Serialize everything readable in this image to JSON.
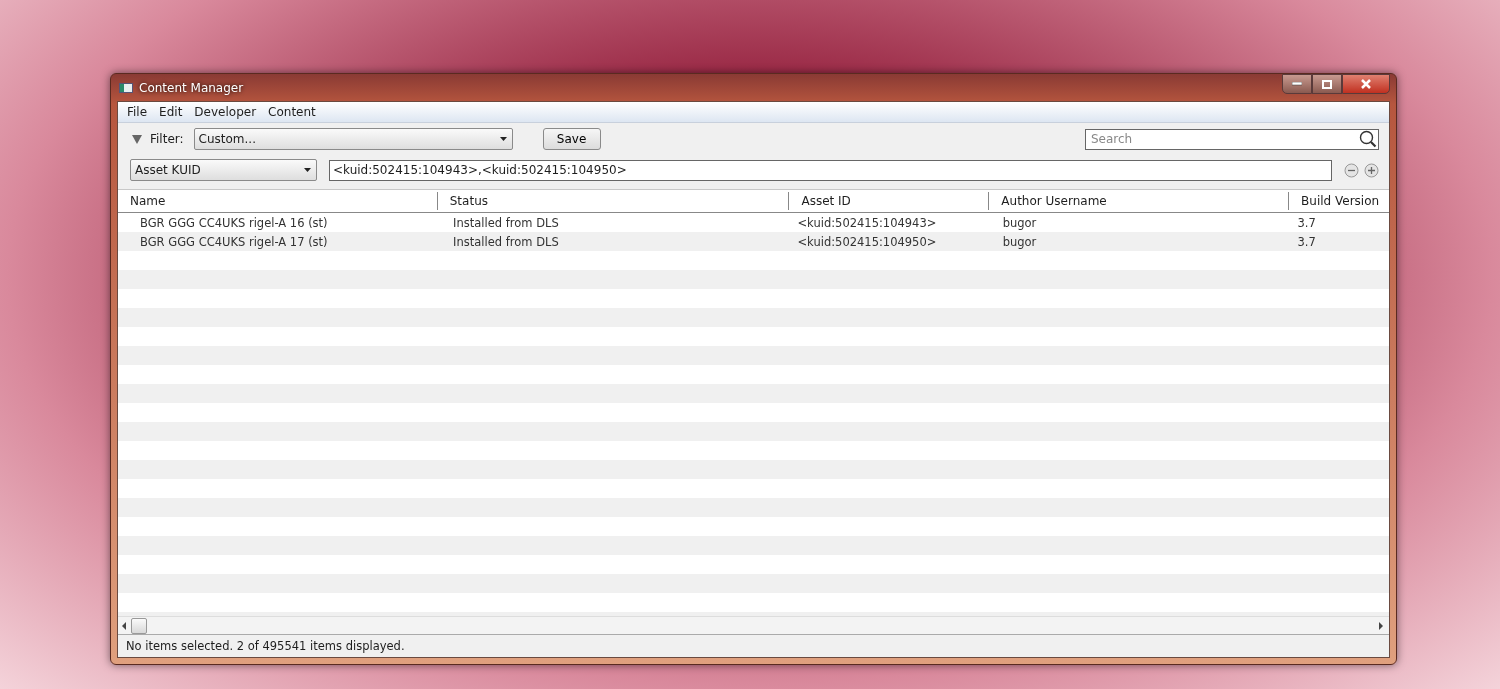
{
  "window": {
    "title": "Content Manager"
  },
  "menu": [
    "File",
    "Edit",
    "Developer",
    "Content"
  ],
  "filter": {
    "label": "Filter:",
    "value": "Custom...",
    "save": "Save",
    "search_placeholder": "Search"
  },
  "query": {
    "field": "Asset KUID",
    "value": "<kuid:502415:104943>,<kuid:502415:104950>"
  },
  "table": {
    "columns": [
      "Name",
      "Status",
      "Asset ID",
      "Author Username",
      "Build Version"
    ],
    "rows": [
      {
        "name": "BGR GGG CC4UKS rigel-A 16 (st)",
        "status": "Installed from DLS",
        "asset_id": "<kuid:502415:104943>",
        "author": "bugor",
        "build": "3.7"
      },
      {
        "name": "BGR GGG CC4UKS rigel-A 17 (st)",
        "status": "Installed from DLS",
        "asset_id": "<kuid:502415:104950>",
        "author": "bugor",
        "build": "3.7"
      }
    ]
  },
  "status_bar": "No items selected. 2 of 495541 items displayed."
}
